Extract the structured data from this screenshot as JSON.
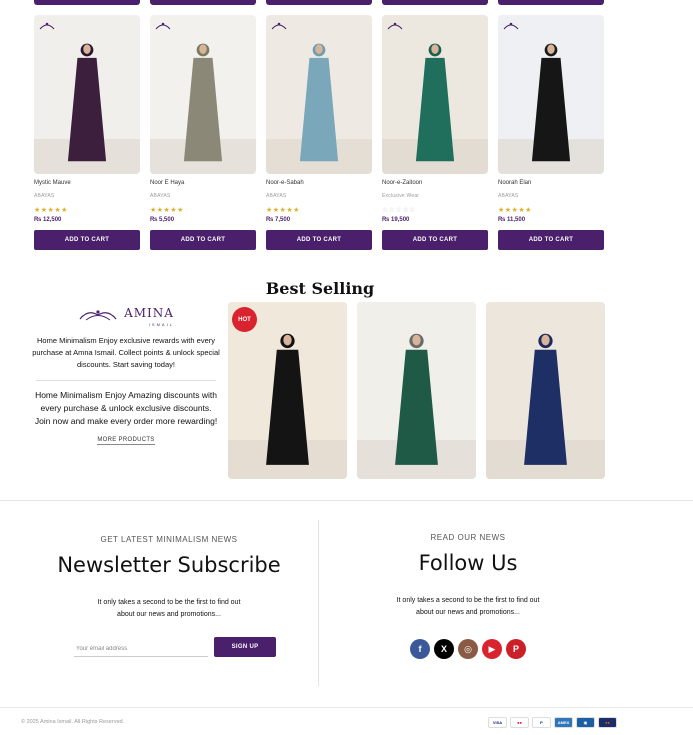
{
  "products": [
    {
      "name": "Mystic Mauve",
      "category": "ABAYAS",
      "stars": "★★★★★",
      "rated": true,
      "price": "₨ 12,500",
      "cta": "ADD TO CART",
      "bg": "#f1efec",
      "dress": "#3b1f3d",
      "hijab": "#2a1830"
    },
    {
      "name": "Noor E Haya",
      "category": "ABAYAS",
      "stars": "★★★★★",
      "rated": true,
      "price": "₨ 5,500",
      "cta": "ADD TO CART",
      "bg": "#f2f1ee",
      "dress": "#8c8877",
      "hijab": "#7a7a5e"
    },
    {
      "name": "Noor-e-Sabah",
      "category": "ABAYAS",
      "stars": "★★★★★",
      "rated": true,
      "price": "₨ 7,500",
      "cta": "ADD TO CART",
      "bg": "#eeeae3",
      "dress": "#7aa7b9",
      "hijab": "#6f9db2"
    },
    {
      "name": "Noor-e-Zaitoon",
      "category": "Exclusive Wear",
      "stars": "☆☆☆☆☆",
      "rated": false,
      "price": "₨ 19,500",
      "cta": "ADD TO CART",
      "bg": "#ece7df",
      "dress": "#1f6f5c",
      "hijab": "#1c5f4f"
    },
    {
      "name": "Noorah Elan",
      "category": "ABAYAS",
      "stars": "★★★★★",
      "rated": true,
      "price": "₨ 11,500",
      "cta": "ADD TO CART",
      "bg": "#eef0f3",
      "dress": "#161616",
      "hijab": "#1b1b1b"
    }
  ],
  "best_selling": {
    "title": "Best Selling",
    "brand": "AMINA",
    "brand_sub": "ISMAIL",
    "promo_1": "Home Minimalism  Enjoy exclusive rewards with every purchase at Amna Ismail. Collect points & unlock special discounts. Start saving today!",
    "promo_2": "Home Minimalism Enjoy Amazing discounts with every purchase & unlock exclusive discounts. Join now and make every order more rewarding!",
    "more_label": "MORE PRODUCTS",
    "hot_label": "HOT",
    "items": [
      {
        "bg": "#f0e8da",
        "dress": "#141414",
        "hijab": "#121212"
      },
      {
        "bg": "#f1efea",
        "dress": "#1f5a47",
        "hijab": "#6a6a6a"
      },
      {
        "bg": "#ede6dc",
        "dress": "#1e2f66",
        "hijab": "#1e2a5e"
      }
    ]
  },
  "newsletter": {
    "eyebrow": "GET LATEST MINIMALISM NEWS",
    "title": "Newsletter Subscribe",
    "copy": "It only takes a second to be the first to find out about our news and promotions...",
    "placeholder": "Your email address",
    "button": "SIGN UP"
  },
  "follow": {
    "eyebrow": "READ OUR NEWS",
    "title": "Follow Us",
    "copy": "It only takes a second to be the first to find out about our news and promotions...",
    "socials": [
      {
        "name": "facebook-icon",
        "glyph": "f",
        "color": "#3b5998"
      },
      {
        "name": "x-icon",
        "glyph": "X",
        "color": "#000000"
      },
      {
        "name": "instagram-icon",
        "glyph": "◎",
        "color": "#8a5a44"
      },
      {
        "name": "youtube-icon",
        "glyph": "▶",
        "color": "#d9232e"
      },
      {
        "name": "pinterest-icon",
        "glyph": "P",
        "color": "#cb2027"
      }
    ]
  },
  "footer": {
    "copyright": "© 2025 Amina Ismail. All Rights Reserved.",
    "payments": [
      {
        "name": "visa-icon",
        "label": "VISA",
        "bg": "#ffffff",
        "fg": "#1a1f71"
      },
      {
        "name": "mastercard-icon",
        "label": "●●",
        "bg": "#ffffff",
        "fg": "#eb001b"
      },
      {
        "name": "paypal-icon",
        "label": "P",
        "bg": "#ffffff",
        "fg": "#003087"
      },
      {
        "name": "amex-icon",
        "label": "AMEX",
        "bg": "#2e77bb",
        "fg": "#ffffff"
      },
      {
        "name": "wallet-icon",
        "label": "▣",
        "bg": "#1d5fa3",
        "fg": "#ffffff"
      },
      {
        "name": "maestro-icon",
        "label": "●●",
        "bg": "#1b2e6b",
        "fg": "#ff5f00"
      }
    ]
  },
  "colors": {
    "brand": "#4a1f6b",
    "star": "#d9b22f",
    "hot": "#d9232e"
  }
}
